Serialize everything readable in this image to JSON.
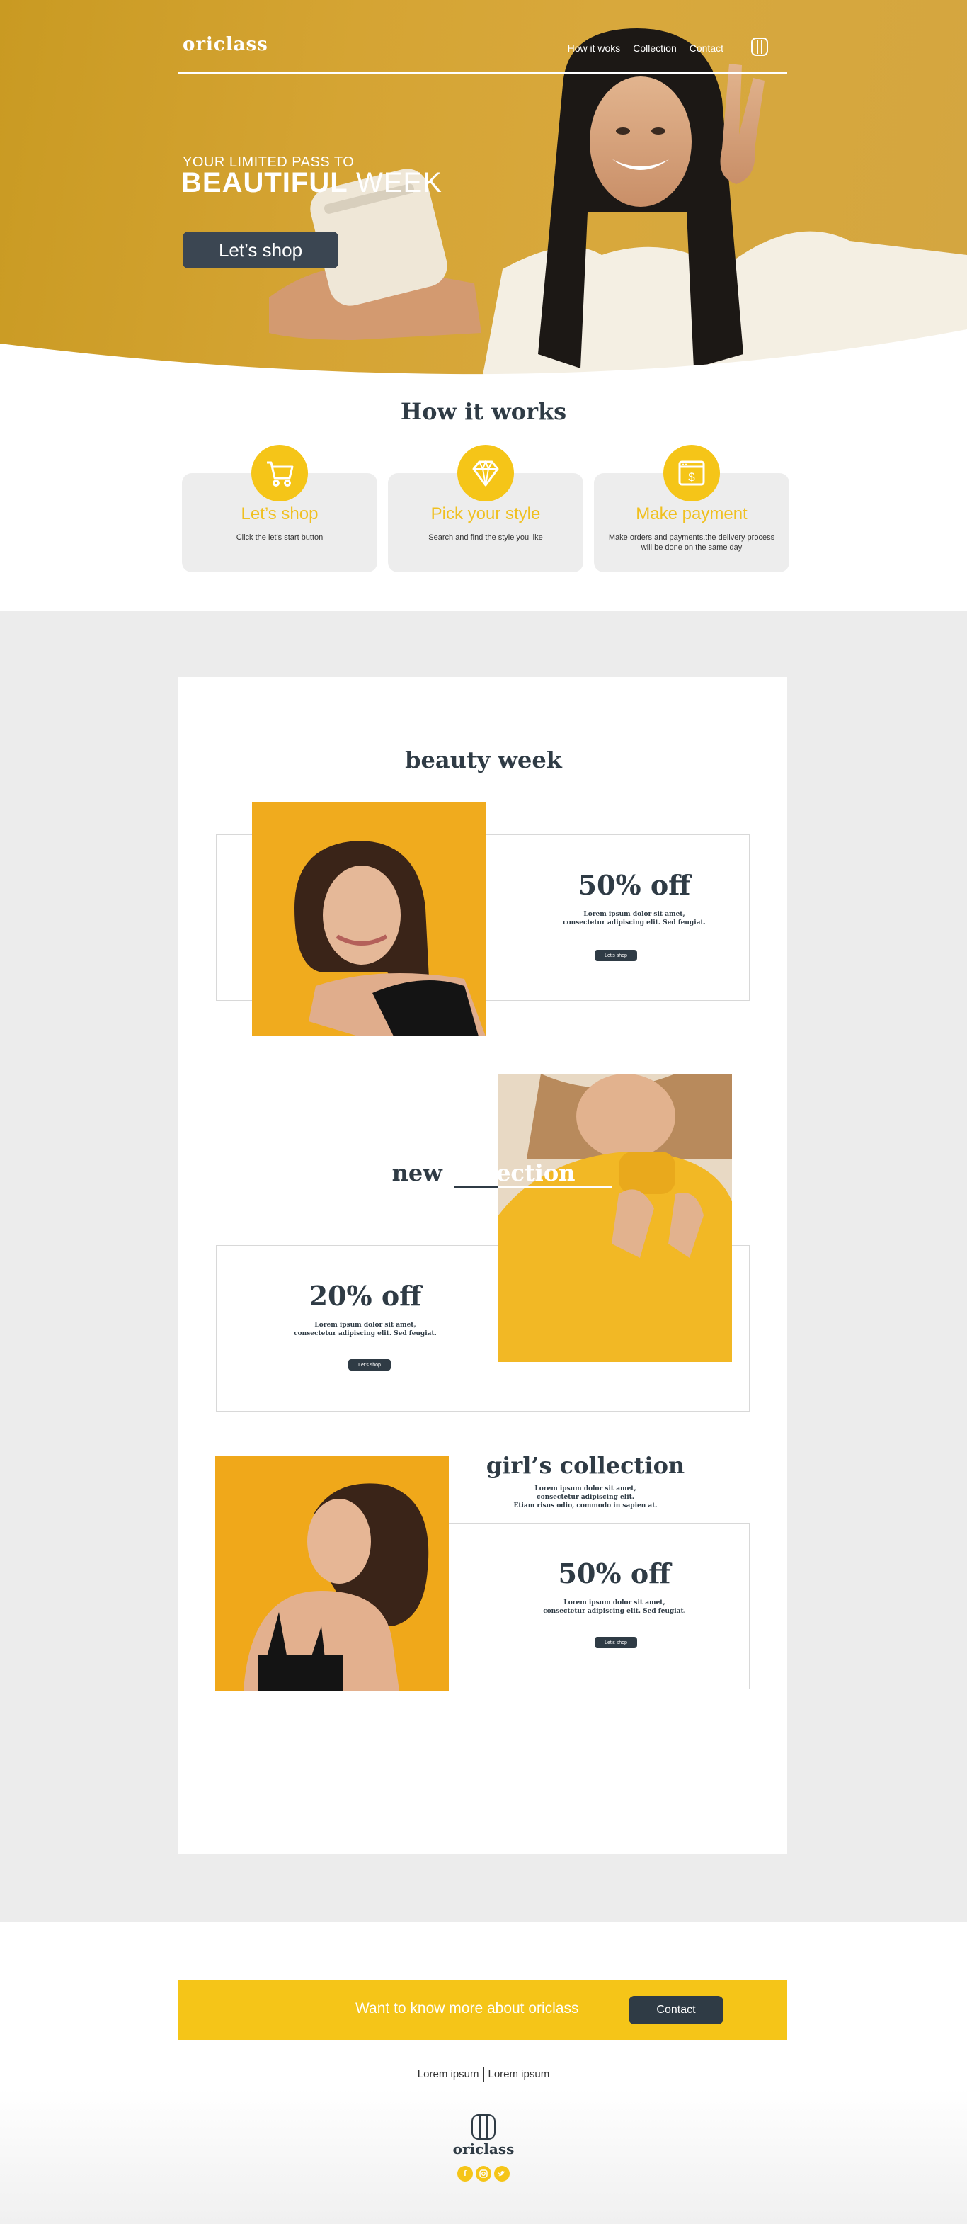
{
  "header": {
    "logo": "oriclass",
    "nav": [
      "How it woks",
      "Collection",
      "Contact"
    ],
    "hero_subtitle": "YOUR LIMITED PASS TO",
    "hero_title_bold": "BEAUTIFUL",
    "hero_title_light": "WEEK",
    "hero_button": "Let’s shop"
  },
  "how": {
    "title": "How it works",
    "cards": [
      {
        "icon": "cart-icon",
        "title": "Let’s shop",
        "text": "Click the let's start button"
      },
      {
        "icon": "diamond-icon",
        "title": "Pick your style",
        "text": "Search and find the style you like"
      },
      {
        "icon": "payment-icon",
        "title": "Make payment",
        "text": "Make orders and payments.the delivery process will be done on the same day"
      }
    ]
  },
  "collections": {
    "beauty": {
      "title": "beauty week",
      "percent": "50% off",
      "text1": "Lorem ipsum dolor sit amet,",
      "text2": "consectetur adipiscing elit. Sed feugiat.",
      "button": "Let’s shop"
    },
    "new": {
      "title_a": "new",
      "title_b": "collection",
      "percent": "20% off",
      "text1": "Lorem ipsum dolor sit amet,",
      "text2": "consectetur adipiscing elit. Sed feugiat.",
      "button": "Let’s shop"
    },
    "girls": {
      "title": "girl’s collection",
      "desc1": "Lorem ipsum dolor sit amet,",
      "desc2": "consectetur adipiscing elit.",
      "desc3": "Etiam risus odio, commodo in sapien at.",
      "percent": "50% off",
      "text1": "Lorem ipsum dolor sit amet,",
      "text2": "consectetur adipiscing elit. Sed feugiat.",
      "button": "Let’s shop"
    }
  },
  "footer": {
    "cta_text": "Want to know more about oriclass",
    "cta_button": "Contact",
    "link1": "Lorem ipsum",
    "link2": "Lorem ipsum",
    "logo": "oriclass",
    "social": [
      "facebook-icon",
      "instagram-icon",
      "twitter-icon"
    ]
  },
  "colors": {
    "accent": "#f5c518",
    "dark": "#2f3b45",
    "hero_bg": "#d5a433",
    "photo_bg": "#f0ab1e"
  }
}
